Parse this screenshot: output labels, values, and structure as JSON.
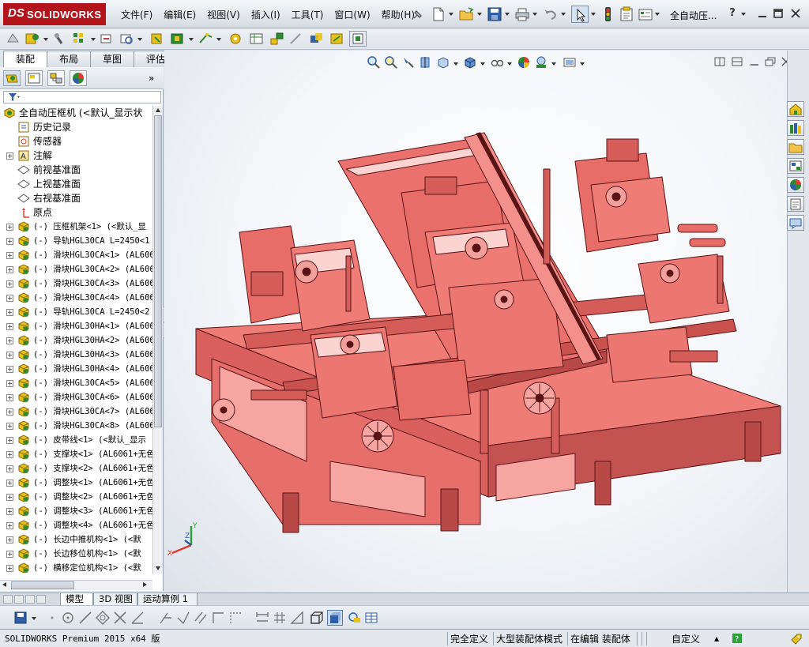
{
  "app": {
    "logo_ds": "DS",
    "logo_name": "SOLIDWORKS",
    "doc_title": "全自动压...",
    "help": "?"
  },
  "menu": [
    "文件(F)",
    "编辑(E)",
    "视图(V)",
    "插入(I)",
    "工具(T)",
    "窗口(W)",
    "帮助(H)"
  ],
  "tabs": [
    "装配体",
    "布局",
    "草图",
    "评估"
  ],
  "tree": {
    "root": "全自动压框机  (<默认_显示状",
    "features": [
      "历史记录",
      "传感器",
      "注解",
      "前视基准面",
      "上视基准面",
      "右视基准面",
      "原点"
    ],
    "components": [
      "(-) 压框机架<1> (<默认_显",
      "(-) 导轨HGL30CA  L=2450<1",
      "(-) 滑块HGL30CA<1> (AL606",
      "(-) 滑块HGL30CA<2> (AL606",
      "(-) 滑块HGL30CA<3> (AL606",
      "(-) 滑块HGL30CA<4> (AL606",
      "(-) 导轨HGL30CA  L=2450<2",
      "(-) 滑块HGL30HA<1> (AL606",
      "(-) 滑块HGL30HA<2> (AL606",
      "(-) 滑块HGL30HA<3> (AL606",
      "(-) 滑块HGL30HA<4> (AL606",
      "(-) 滑块HGL30CA<5> (AL606",
      "(-) 滑块HGL30CA<6> (AL606",
      "(-) 滑块HGL30CA<7> (AL606",
      "(-) 滑块HGL30CA<8> (AL606",
      "(-) 皮带线<1> (<默认_显示",
      "(-) 支撑块<1> (AL6061+无色",
      "(-) 支撑块<2> (AL6061+无色",
      "(-) 调整块<1> (AL6061+无色",
      "(-) 调整块<2> (AL6061+无色",
      "(-) 调整块<3> (AL6061+无色",
      "(-) 调整块<4> (AL6061+无色",
      "(-) 长边中推机构<1> (<默",
      "(-) 长边移位机构<1> (<默",
      "(-) 横移定位机构<1> (<默"
    ]
  },
  "bottom_tabs": [
    "模型",
    "3D 视图",
    "运动算例 1"
  ],
  "status": {
    "version": "SOLIDWORKS Premium 2015 x64 版",
    "defined": "完全定义",
    "mode": "大型装配体模式",
    "editing": "在编辑 装配体",
    "units": "自定义",
    "units_arrow": "▲"
  },
  "triad": {
    "x": "X",
    "y": "Y",
    "z": "Z"
  },
  "colors": {
    "model": "#f07c78",
    "model_edge": "#5a1416",
    "brand_red": "#b3141c",
    "tree_icon_yellow": "#e8c21a"
  }
}
